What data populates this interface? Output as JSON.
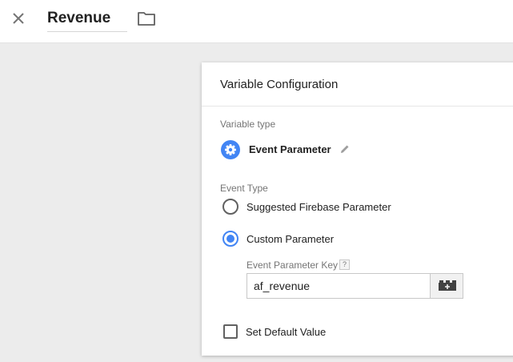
{
  "header": {
    "close_icon": "close-icon",
    "title": "Revenue",
    "folder_icon": "folder-icon"
  },
  "card": {
    "title": "Variable Configuration",
    "variable_type_label": "Variable type",
    "variable_type_icon": "gear-icon",
    "variable_type_name": "Event Parameter",
    "edit_icon": "pencil-icon",
    "event_type_label": "Event Type",
    "options": [
      {
        "label": "Suggested Firebase Parameter",
        "selected": false
      },
      {
        "label": "Custom Parameter",
        "selected": true
      }
    ],
    "key_label": "Event Parameter Key",
    "help_text": "?",
    "key_value": "af_revenue",
    "variable_picker_icon": "variable-picker-icon",
    "default_value_label": "Set Default Value",
    "default_value_checked": false
  },
  "colors": {
    "accent": "#4285f4",
    "background": "#ececec"
  }
}
